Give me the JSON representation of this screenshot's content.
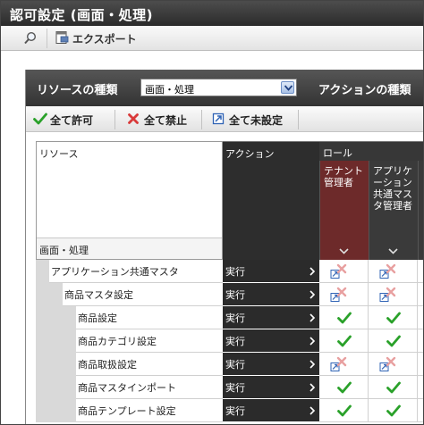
{
  "window": {
    "title": "認可設定 (画面・処理)"
  },
  "toolbar": {
    "export_label": "エクスポート"
  },
  "filter": {
    "resource_type_label": "リソースの種類",
    "resource_type_value": "画面・処理",
    "action_type_label": "アクションの種類"
  },
  "actions": {
    "allow_all": "全て許可",
    "deny_all": "全て禁止",
    "unset_all": "全て未設定"
  },
  "grid": {
    "resource_header": "リソース",
    "resource_subheader": "画面・処理",
    "action_header": "アクション",
    "role_header": "ロール",
    "roles": [
      {
        "name": "テナント管理者"
      },
      {
        "name": "アプリケーション共通マスタ管理者"
      }
    ],
    "rows": [
      {
        "name": "アプリケーション共通マスタ",
        "level": 1,
        "action": "実行",
        "perms": [
          "inherit-deny",
          "inherit-deny"
        ]
      },
      {
        "name": "商品マスタ設定",
        "level": 2,
        "action": "実行",
        "perms": [
          "inherit-deny",
          "inherit-deny"
        ]
      },
      {
        "name": "商品設定",
        "level": 3,
        "action": "実行",
        "perms": [
          "allow",
          "allow"
        ]
      },
      {
        "name": "商品カテゴリ設定",
        "level": 3,
        "action": "実行",
        "perms": [
          "allow",
          "allow"
        ]
      },
      {
        "name": "商品取扱設定",
        "level": 3,
        "action": "実行",
        "perms": [
          "inherit-deny",
          "inherit-deny"
        ]
      },
      {
        "name": "商品マスタインポート",
        "level": 3,
        "action": "実行",
        "perms": [
          "allow",
          "allow"
        ]
      },
      {
        "name": "商品テンプレート設定",
        "level": 3,
        "action": "実行",
        "perms": [
          "allow",
          "allow"
        ]
      }
    ]
  },
  "colors": {
    "allow": "#2aa12a",
    "deny": "#d93a3a",
    "deny_faint": "#e8a0a0",
    "role_selected": "#6d2a2a",
    "link_icon": "#2f63b5"
  }
}
